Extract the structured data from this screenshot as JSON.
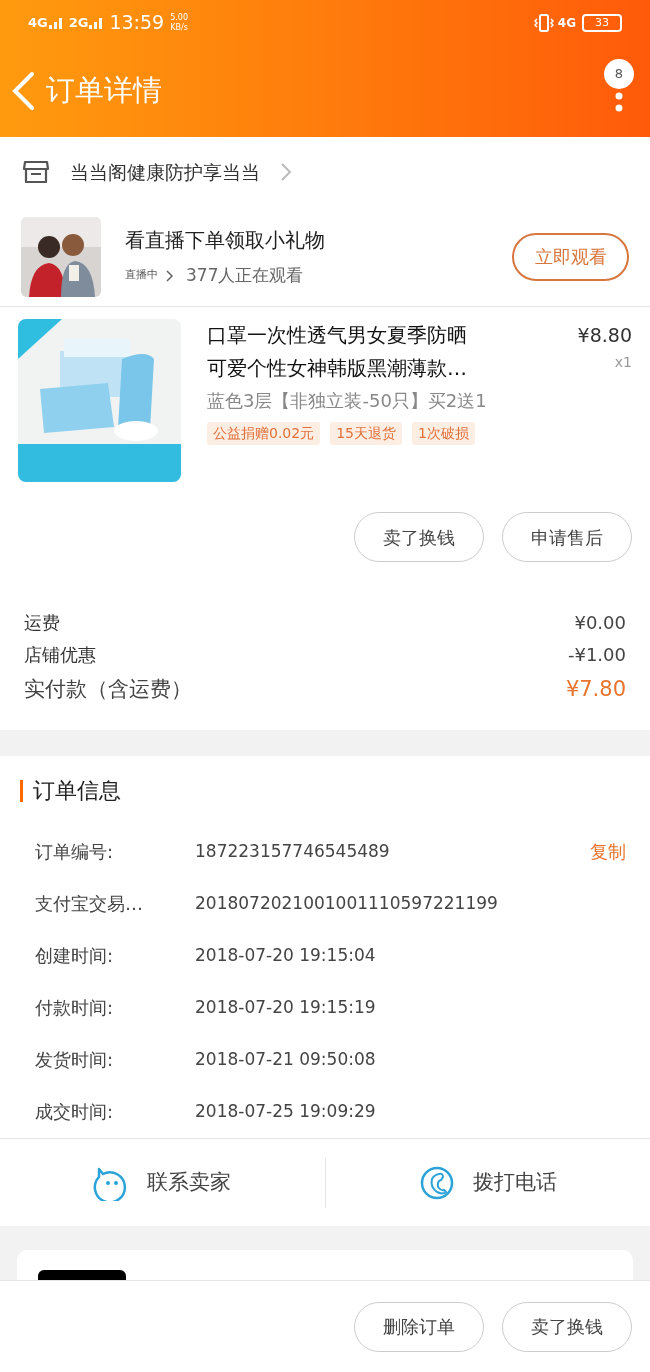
{
  "status_bar": {
    "signal_1": "4G",
    "signal_2": "2G",
    "time": "13:59",
    "speed": "5.00",
    "speed_unit": "KB/s",
    "network": "4G",
    "battery": "33"
  },
  "header": {
    "title": "订单详情",
    "badge": "8"
  },
  "store": {
    "name": "当当阁健康防护享当当"
  },
  "live": {
    "title": "看直播下单领取小礼物",
    "tag": "直播中",
    "viewers": "377人正在观看",
    "button": "立即观看"
  },
  "product": {
    "title": "口罩一次性透气男女夏季防晒可爱个性女神韩版黑潮薄款…",
    "price": "¥8.80",
    "quantity": "x1",
    "sku": "蓝色3层【非独立装-50只】买2送1",
    "tags": [
      "公益捐赠0.02元",
      "15天退货",
      "1次破损"
    ],
    "buttons": [
      "卖了换钱",
      "申请售后"
    ]
  },
  "fees": [
    {
      "kind": "normal",
      "label": "运费",
      "value": "¥0.00"
    },
    {
      "kind": "normal",
      "label": "店铺优惠",
      "value": "-¥1.00"
    },
    {
      "kind": "total",
      "label": "实付款（含运费）",
      "value": "¥7.80"
    }
  ],
  "order_info": {
    "title": "订单信息",
    "copy": "复制",
    "rows": [
      {
        "label": "订单编号:",
        "value": "187223157746545489"
      },
      {
        "label": "支付宝交易…",
        "value": "2018072021001001110597221199"
      },
      {
        "label": "创建时间:",
        "value": "2018-07-20 19:15:04"
      },
      {
        "label": "付款时间:",
        "value": "2018-07-20 19:15:19"
      },
      {
        "label": "发货时间:",
        "value": "2018-07-21 09:50:08"
      },
      {
        "label": "成交时间:",
        "value": "2018-07-25 19:09:29"
      }
    ]
  },
  "contact": [
    {
      "kind": "chat",
      "label": "联系卖家"
    },
    {
      "kind": "phone",
      "label": "拨打电话"
    }
  ],
  "bottom_buttons": [
    "删除订单",
    "卖了换钱"
  ]
}
